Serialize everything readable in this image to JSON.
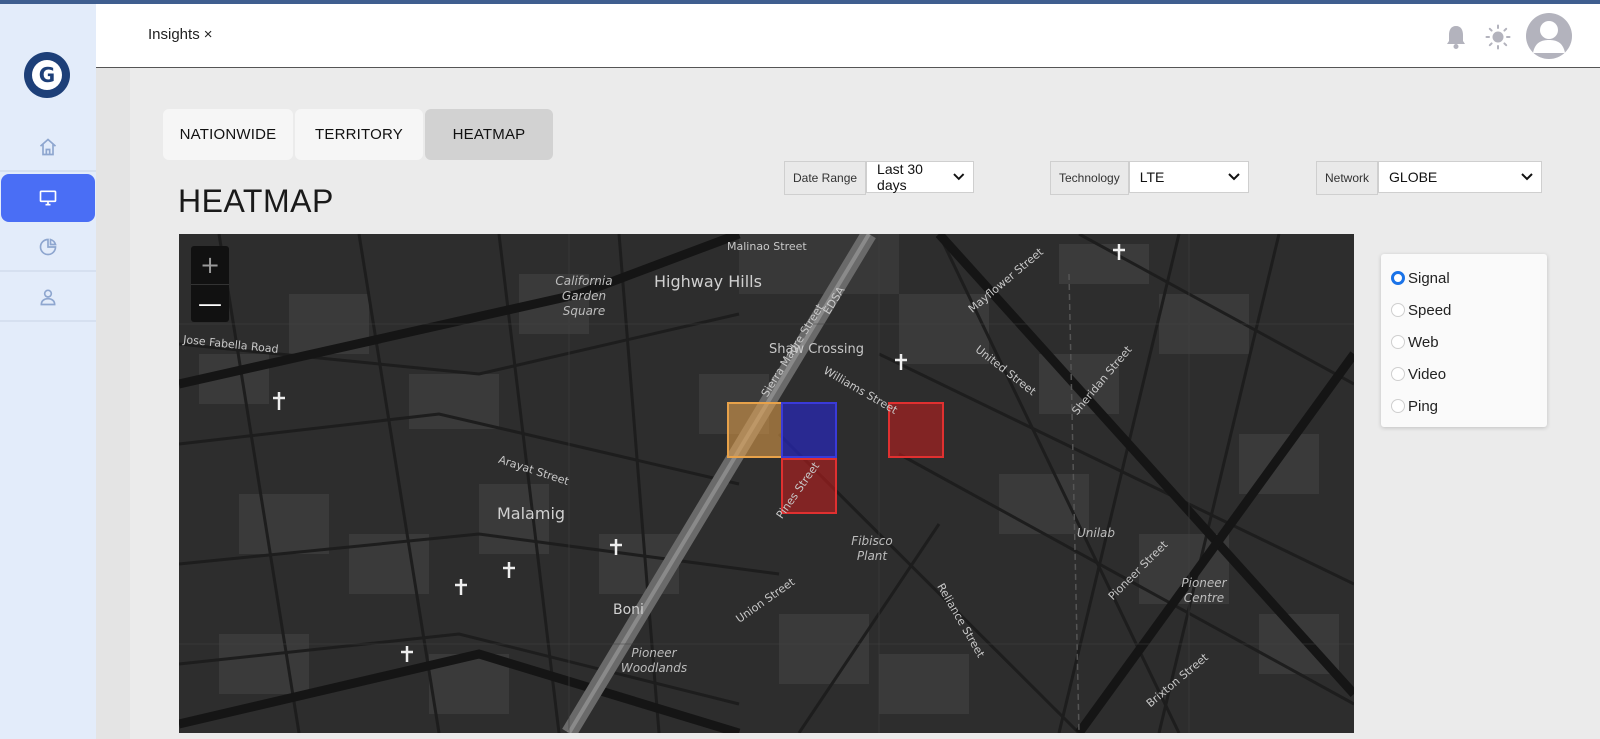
{
  "header": {
    "tab_label": "Insights",
    "tab_close": "×",
    "icons": [
      "bell-icon",
      "sun-icon",
      "avatar"
    ]
  },
  "sidebar": {
    "logo": "G",
    "items": [
      {
        "icon": "home-icon",
        "active": false
      },
      {
        "icon": "monitor-icon",
        "active": true
      },
      {
        "icon": "pie-chart-icon",
        "active": false
      },
      {
        "icon": "user-icon",
        "active": false
      }
    ]
  },
  "tabs": [
    "NATIONWIDE",
    "TERRITORY",
    "HEATMAP"
  ],
  "selected_tab": "HEATMAP",
  "page_title": "HEATMAP",
  "filters": {
    "date_range": {
      "label": "Date Range",
      "value": "Last 30 days"
    },
    "technology": {
      "label": "Technology",
      "value": "LTE"
    },
    "network": {
      "label": "Network",
      "value": "GLOBE"
    }
  },
  "map": {
    "zoom_in": "+",
    "zoom_out": "—",
    "labels": {
      "highway_hills": "Highway Hills",
      "malamig": "Malamig",
      "boni": "Boni",
      "shaw_crossing": "Shaw Crossing",
      "california_garden": "California Garden Square",
      "fibisco": "Fibisco Plant",
      "unilab": "Unilab",
      "pioneer_centre": "Pioneer Centre",
      "pioneer_woodlands": "Pioneer Woodlands",
      "edsa": "EDSA",
      "malinao": "Malinao Street",
      "union": "Union Street",
      "reliance": "Reliance Street",
      "williams": "Williams Street",
      "jose_fabella": "Jose Fabella Road",
      "sierra_madre": "Sierra Madre Street",
      "arayat": "Arayat Street",
      "pines": "Pines Street",
      "united": "United Street",
      "brixton": "Brixton Street",
      "pioneer_st": "Pioneer Street",
      "mayflower": "Mayflower Street",
      "sheridan": "Sheridan Street"
    },
    "colors": {
      "orange": "#e8a24a",
      "blue": "#3a3ad8",
      "red": "#e03030"
    }
  },
  "metrics": {
    "options": [
      "Signal",
      "Speed",
      "Web",
      "Video",
      "Ping"
    ],
    "selected": "Signal"
  }
}
